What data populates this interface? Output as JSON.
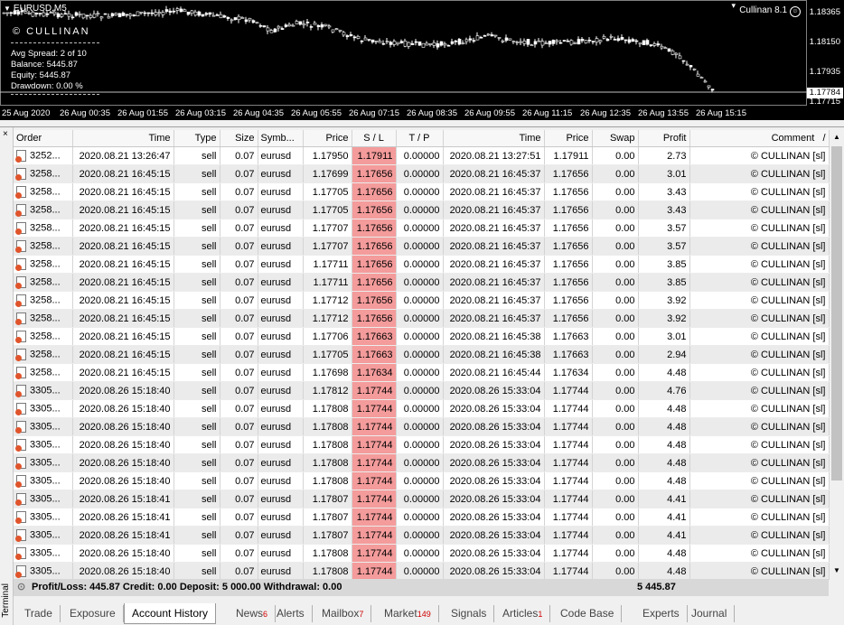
{
  "chart": {
    "symbol": "EURUSD,M5",
    "brand": "© CULLINAN",
    "info": [
      "Avg Spread:  2 of 10",
      "Balance:  5445.87",
      "Equity:  5445.87",
      "Drawdown:  0.00 %"
    ],
    "ea_name": "Cullinan 8.1",
    "ea_icon": "smiley-icon",
    "prices": [
      "1.18365",
      "1.18150",
      "1.17935",
      "1.17715"
    ],
    "current_price": "1.17784",
    "times": [
      "25 Aug 2020",
      "26 Aug 00:35",
      "26 Aug 01:55",
      "26 Aug 03:15",
      "26 Aug 04:35",
      "26 Aug 05:55",
      "26 Aug 07:15",
      "26 Aug 08:35",
      "26 Aug 09:55",
      "26 Aug 11:15",
      "26 Aug 12:35",
      "26 Aug 13:55",
      "26 Aug 15:15"
    ],
    "colors": {
      "background": "#000000",
      "candle": "#ffffff",
      "bid_line": "#c0c0c0"
    }
  },
  "terminal": {
    "side_label": "Terminal",
    "close_icon": "×",
    "columns": [
      "Order",
      "Time",
      "Type",
      "Size",
      "Symb...",
      "Price",
      "S / L",
      "T / P",
      "Time",
      "Price",
      "Swap",
      "Profit",
      "Comment"
    ],
    "sort_indicator": "/",
    "rows": [
      [
        "3252...",
        "2020.08.21 13:26:47",
        "sell",
        "0.07",
        "eurusd",
        "1.17950",
        "1.17911",
        "0.00000",
        "2020.08.21 13:27:51",
        "1.17911",
        "0.00",
        "2.73",
        "© CULLINAN [sl]"
      ],
      [
        "3258...",
        "2020.08.21 16:45:15",
        "sell",
        "0.07",
        "eurusd",
        "1.17699",
        "1.17656",
        "0.00000",
        "2020.08.21 16:45:37",
        "1.17656",
        "0.00",
        "3.01",
        "© CULLINAN [sl]"
      ],
      [
        "3258...",
        "2020.08.21 16:45:15",
        "sell",
        "0.07",
        "eurusd",
        "1.17705",
        "1.17656",
        "0.00000",
        "2020.08.21 16:45:37",
        "1.17656",
        "0.00",
        "3.43",
        "© CULLINAN [sl]"
      ],
      [
        "3258...",
        "2020.08.21 16:45:15",
        "sell",
        "0.07",
        "eurusd",
        "1.17705",
        "1.17656",
        "0.00000",
        "2020.08.21 16:45:37",
        "1.17656",
        "0.00",
        "3.43",
        "© CULLINAN [sl]"
      ],
      [
        "3258...",
        "2020.08.21 16:45:15",
        "sell",
        "0.07",
        "eurusd",
        "1.17707",
        "1.17656",
        "0.00000",
        "2020.08.21 16:45:37",
        "1.17656",
        "0.00",
        "3.57",
        "© CULLINAN [sl]"
      ],
      [
        "3258...",
        "2020.08.21 16:45:15",
        "sell",
        "0.07",
        "eurusd",
        "1.17707",
        "1.17656",
        "0.00000",
        "2020.08.21 16:45:37",
        "1.17656",
        "0.00",
        "3.57",
        "© CULLINAN [sl]"
      ],
      [
        "3258...",
        "2020.08.21 16:45:15",
        "sell",
        "0.07",
        "eurusd",
        "1.17711",
        "1.17656",
        "0.00000",
        "2020.08.21 16:45:37",
        "1.17656",
        "0.00",
        "3.85",
        "© CULLINAN [sl]"
      ],
      [
        "3258...",
        "2020.08.21 16:45:15",
        "sell",
        "0.07",
        "eurusd",
        "1.17711",
        "1.17656",
        "0.00000",
        "2020.08.21 16:45:37",
        "1.17656",
        "0.00",
        "3.85",
        "© CULLINAN [sl]"
      ],
      [
        "3258...",
        "2020.08.21 16:45:15",
        "sell",
        "0.07",
        "eurusd",
        "1.17712",
        "1.17656",
        "0.00000",
        "2020.08.21 16:45:37",
        "1.17656",
        "0.00",
        "3.92",
        "© CULLINAN [sl]"
      ],
      [
        "3258...",
        "2020.08.21 16:45:15",
        "sell",
        "0.07",
        "eurusd",
        "1.17712",
        "1.17656",
        "0.00000",
        "2020.08.21 16:45:37",
        "1.17656",
        "0.00",
        "3.92",
        "© CULLINAN [sl]"
      ],
      [
        "3258...",
        "2020.08.21 16:45:15",
        "sell",
        "0.07",
        "eurusd",
        "1.17706",
        "1.17663",
        "0.00000",
        "2020.08.21 16:45:38",
        "1.17663",
        "0.00",
        "3.01",
        "© CULLINAN [sl]"
      ],
      [
        "3258...",
        "2020.08.21 16:45:15",
        "sell",
        "0.07",
        "eurusd",
        "1.17705",
        "1.17663",
        "0.00000",
        "2020.08.21 16:45:38",
        "1.17663",
        "0.00",
        "2.94",
        "© CULLINAN [sl]"
      ],
      [
        "3258...",
        "2020.08.21 16:45:15",
        "sell",
        "0.07",
        "eurusd",
        "1.17698",
        "1.17634",
        "0.00000",
        "2020.08.21 16:45:44",
        "1.17634",
        "0.00",
        "4.48",
        "© CULLINAN [sl]"
      ],
      [
        "3305...",
        "2020.08.26 15:18:40",
        "sell",
        "0.07",
        "eurusd",
        "1.17812",
        "1.17744",
        "0.00000",
        "2020.08.26 15:33:04",
        "1.17744",
        "0.00",
        "4.76",
        "© CULLINAN [sl]"
      ],
      [
        "3305...",
        "2020.08.26 15:18:40",
        "sell",
        "0.07",
        "eurusd",
        "1.17808",
        "1.17744",
        "0.00000",
        "2020.08.26 15:33:04",
        "1.17744",
        "0.00",
        "4.48",
        "© CULLINAN [sl]"
      ],
      [
        "3305...",
        "2020.08.26 15:18:40",
        "sell",
        "0.07",
        "eurusd",
        "1.17808",
        "1.17744",
        "0.00000",
        "2020.08.26 15:33:04",
        "1.17744",
        "0.00",
        "4.48",
        "© CULLINAN [sl]"
      ],
      [
        "3305...",
        "2020.08.26 15:18:40",
        "sell",
        "0.07",
        "eurusd",
        "1.17808",
        "1.17744",
        "0.00000",
        "2020.08.26 15:33:04",
        "1.17744",
        "0.00",
        "4.48",
        "© CULLINAN [sl]"
      ],
      [
        "3305...",
        "2020.08.26 15:18:40",
        "sell",
        "0.07",
        "eurusd",
        "1.17808",
        "1.17744",
        "0.00000",
        "2020.08.26 15:33:04",
        "1.17744",
        "0.00",
        "4.48",
        "© CULLINAN [sl]"
      ],
      [
        "3305...",
        "2020.08.26 15:18:40",
        "sell",
        "0.07",
        "eurusd",
        "1.17808",
        "1.17744",
        "0.00000",
        "2020.08.26 15:33:04",
        "1.17744",
        "0.00",
        "4.48",
        "© CULLINAN [sl]"
      ],
      [
        "3305...",
        "2020.08.26 15:18:41",
        "sell",
        "0.07",
        "eurusd",
        "1.17807",
        "1.17744",
        "0.00000",
        "2020.08.26 15:33:04",
        "1.17744",
        "0.00",
        "4.41",
        "© CULLINAN [sl]"
      ],
      [
        "3305...",
        "2020.08.26 15:18:41",
        "sell",
        "0.07",
        "eurusd",
        "1.17807",
        "1.17744",
        "0.00000",
        "2020.08.26 15:33:04",
        "1.17744",
        "0.00",
        "4.41",
        "© CULLINAN [sl]"
      ],
      [
        "3305...",
        "2020.08.26 15:18:41",
        "sell",
        "0.07",
        "eurusd",
        "1.17807",
        "1.17744",
        "0.00000",
        "2020.08.26 15:33:04",
        "1.17744",
        "0.00",
        "4.41",
        "© CULLINAN [sl]"
      ],
      [
        "3305...",
        "2020.08.26 15:18:40",
        "sell",
        "0.07",
        "eurusd",
        "1.17808",
        "1.17744",
        "0.00000",
        "2020.08.26 15:33:04",
        "1.17744",
        "0.00",
        "4.48",
        "© CULLINAN [sl]"
      ],
      [
        "3305...",
        "2020.08.26 15:18:40",
        "sell",
        "0.07",
        "eurusd",
        "1.17808",
        "1.17744",
        "0.00000",
        "2020.08.26 15:33:04",
        "1.17744",
        "0.00",
        "4.48",
        "© CULLINAN [sl]"
      ]
    ],
    "summary": "Profit/Loss: 445.87  Credit: 0.00  Deposit: 5 000.00  Withdrawal: 0.00",
    "summary_balance": "5 445.87",
    "tabs": [
      {
        "label": "Trade",
        "count": ""
      },
      {
        "label": "Exposure",
        "count": ""
      },
      {
        "label": "Account History",
        "count": "",
        "active": true
      },
      {
        "label": "News",
        "count": "6"
      },
      {
        "label": "Alerts",
        "count": ""
      },
      {
        "label": "Mailbox",
        "count": "7"
      },
      {
        "label": "Market",
        "count": "149"
      },
      {
        "label": "Signals",
        "count": ""
      },
      {
        "label": "Articles",
        "count": "1"
      },
      {
        "label": "Code Base",
        "count": ""
      },
      {
        "label": "Experts",
        "count": ""
      },
      {
        "label": "Journal",
        "count": ""
      }
    ],
    "colors": {
      "sl_highlight": "#f49b9b",
      "tab_count": "#d00000"
    }
  }
}
